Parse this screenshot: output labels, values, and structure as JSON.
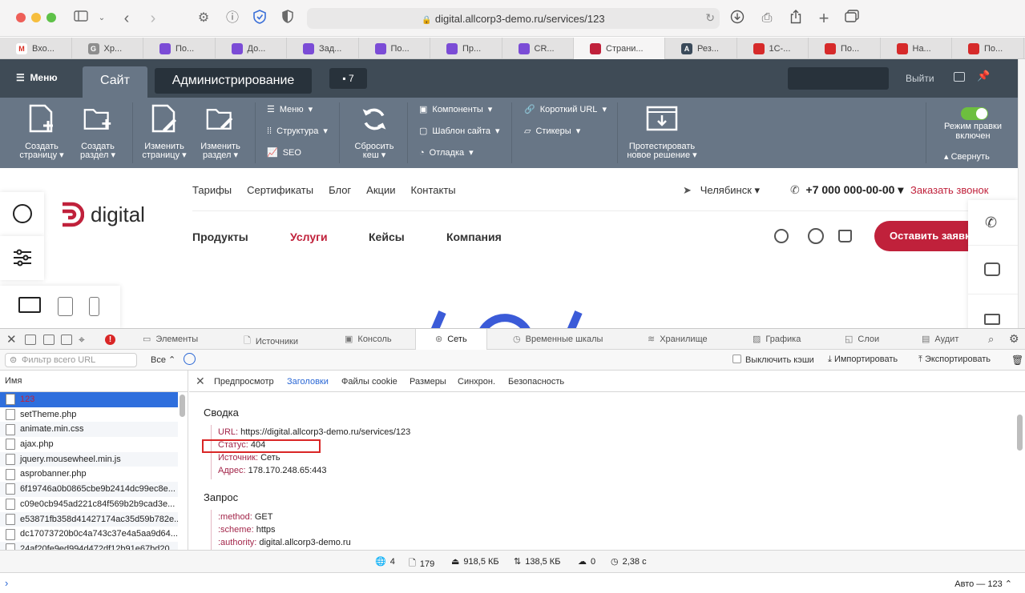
{
  "browser": {
    "url": "digital.allcorp3-demo.ru/services/123",
    "lock_icon": "lock-icon",
    "colors": {
      "close": "#ee5f58",
      "minimize": "#f6be3e",
      "zoom": "#5ec148"
    }
  },
  "tabs": [
    {
      "label": "Вхо...",
      "fav_color": "#ffffff",
      "fav_text": "M",
      "fav_fg": "#d93025"
    },
    {
      "label": "Хр...",
      "fav_color": "#8e8e8e",
      "fav_text": "G",
      "fav_fg": "#ffffff"
    },
    {
      "label": "По...",
      "fav_color": "#7b4cd6",
      "fav_text": "",
      "fav_fg": "#ffffff"
    },
    {
      "label": "До...",
      "fav_color": "#7b4cd6",
      "fav_text": "",
      "fav_fg": "#ffffff"
    },
    {
      "label": "Зад...",
      "fav_color": "#7b4cd6",
      "fav_text": "",
      "fav_fg": "#ffffff"
    },
    {
      "label": "По...",
      "fav_color": "#7b4cd6",
      "fav_text": "",
      "fav_fg": "#ffffff"
    },
    {
      "label": "Пр...",
      "fav_color": "#7b4cd6",
      "fav_text": "",
      "fav_fg": "#ffffff"
    },
    {
      "label": "CR...",
      "fav_color": "#7b4cd6",
      "fav_text": "",
      "fav_fg": "#ffffff"
    },
    {
      "label": "Страни...",
      "fav_color": "#c0213b",
      "fav_text": "",
      "fav_fg": "#ffffff",
      "active": true
    },
    {
      "label": "Рез...",
      "fav_color": "#3a4a5a",
      "fav_text": "A",
      "fav_fg": "#ffffff"
    },
    {
      "label": "1С-...",
      "fav_color": "#d62a2a",
      "fav_text": "",
      "fav_fg": "#ffffff"
    },
    {
      "label": "По...",
      "fav_color": "#d62a2a",
      "fav_text": "",
      "fav_fg": "#ffffff"
    },
    {
      "label": "На...",
      "fav_color": "#d62a2a",
      "fav_text": "",
      "fav_fg": "#ffffff"
    },
    {
      "label": "По...",
      "fav_color": "#d62a2a",
      "fav_text": "",
      "fav_fg": "#ffffff"
    }
  ],
  "admin": {
    "menu": "Меню",
    "site_tab": "Сайт",
    "admin_tab": "Администрирование",
    "notify_count": "7",
    "exit": "Выйти",
    "buttons": {
      "create_page": "Создать страницу",
      "create_section": "Создать раздел",
      "edit_page": "Изменить страницу",
      "edit_section": "Изменить раздел",
      "reset_cache": "Сбросить кеш",
      "test_solution": "Протестировать новое решение"
    },
    "small": {
      "menu": "Меню",
      "structure": "Структура",
      "seo": "SEO",
      "components": "Компоненты",
      "template": "Шаблон сайта",
      "debug": "Отладка",
      "short_url": "Короткий URL",
      "stickers": "Стикеры"
    },
    "edit_mode": "Режим правки включен",
    "collapse": "Свернуть"
  },
  "site": {
    "logo": "digital",
    "top_links": [
      "Тарифы",
      "Сертификаты",
      "Блог",
      "Акции",
      "Контакты"
    ],
    "main_links": [
      "Продукты",
      "Услуги",
      "Кейсы",
      "Компания"
    ],
    "city": "Челябинск",
    "phone": "+7 000 000-00-00",
    "callback": "Заказать звонок",
    "cta": "Оставить заявку",
    "brand_color": "#c0213b"
  },
  "inspector": {
    "tabs": [
      "Элементы",
      "Источники",
      "Консоль",
      "Сеть",
      "Временные шкалы",
      "Хранилище",
      "Графика",
      "Слои",
      "Аудит"
    ],
    "active_tab": "Сеть",
    "filter_placeholder": "Фильтр всего URL",
    "type_select": "Все",
    "disable_cache": "Выключить кэши",
    "import": "Импортировать",
    "export": "Экспортировать",
    "list_header": "Имя",
    "requests": [
      {
        "name": "123",
        "selected": true
      },
      {
        "name": "setTheme.php"
      },
      {
        "name": "animate.min.css"
      },
      {
        "name": "ajax.php"
      },
      {
        "name": "jquery.mousewheel.min.js"
      },
      {
        "name": "asprobanner.php"
      },
      {
        "name": "6f19746a0b0865cbe9b2414dc99ec8e..."
      },
      {
        "name": "c09e0cb945ad221c84f569b2b9cad3e..."
      },
      {
        "name": "e53871fb358d41427174ac35d59b782e..."
      },
      {
        "name": "dc17073720b0c4a743c37e4a5aa9d64..."
      },
      {
        "name": "24af20fe9ed994d472df12b91e67bd20..."
      }
    ],
    "detail_tabs": [
      "Предпросмотр",
      "Заголовки",
      "Файлы cookie",
      "Размеры",
      "Синхрон.",
      "Безопасность"
    ],
    "active_detail_tab": "Заголовки",
    "summary_title": "Сводка",
    "summary": [
      {
        "key": "URL:",
        "value": "https://digital.allcorp3-demo.ru/services/123"
      },
      {
        "key": "Статус:",
        "value": "404"
      },
      {
        "key": "Источник:",
        "value": "Сеть"
      },
      {
        "key": "Адрес:",
        "value": "178.170.248.65:443"
      }
    ],
    "request_title": "Запрос",
    "request": [
      {
        "key": ":method:",
        "value": "GET"
      },
      {
        "key": ":scheme:",
        "value": "https"
      },
      {
        "key": ":authority:",
        "value": "digital.allcorp3-demo.ru"
      }
    ],
    "status": {
      "domains": "4",
      "resources": "179",
      "size": "918,5 КБ",
      "transferred": "138,5 КБ",
      "errors": "0",
      "time": "2,38 с"
    },
    "zoom": "Авто — 123"
  }
}
